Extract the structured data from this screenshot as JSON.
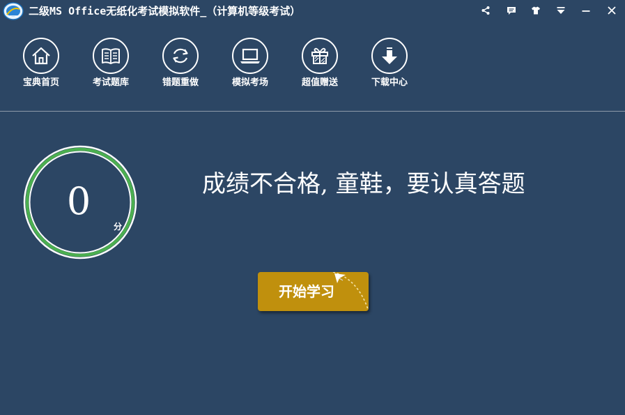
{
  "window": {
    "title": "二级MS Office无纸化考试模拟软件_（计算机等级考试）",
    "controls": [
      {
        "name": "share-icon"
      },
      {
        "name": "message-icon"
      },
      {
        "name": "skin-icon"
      },
      {
        "name": "menu-dropdown-icon"
      },
      {
        "name": "minimize-icon"
      },
      {
        "name": "close-icon"
      }
    ]
  },
  "nav": {
    "items": [
      {
        "label": "宝典首页",
        "icon": "home-icon"
      },
      {
        "label": "考试题库",
        "icon": "book-icon"
      },
      {
        "label": "错题重做",
        "icon": "refresh-icon"
      },
      {
        "label": "模拟考场",
        "icon": "laptop-icon"
      },
      {
        "label": "超值赠送",
        "icon": "gift-icon"
      },
      {
        "label": "下载中心",
        "icon": "download-icon"
      }
    ]
  },
  "score": {
    "value": "0",
    "unit": "分",
    "ring_color": "#4caf50"
  },
  "result": {
    "message": "成绩不合格, 童鞋，要认真答题"
  },
  "actions": {
    "start_label": "开始学习",
    "start_color": "#c0900d"
  },
  "theme": {
    "background": "#2c4664",
    "text": "#ffffff"
  }
}
